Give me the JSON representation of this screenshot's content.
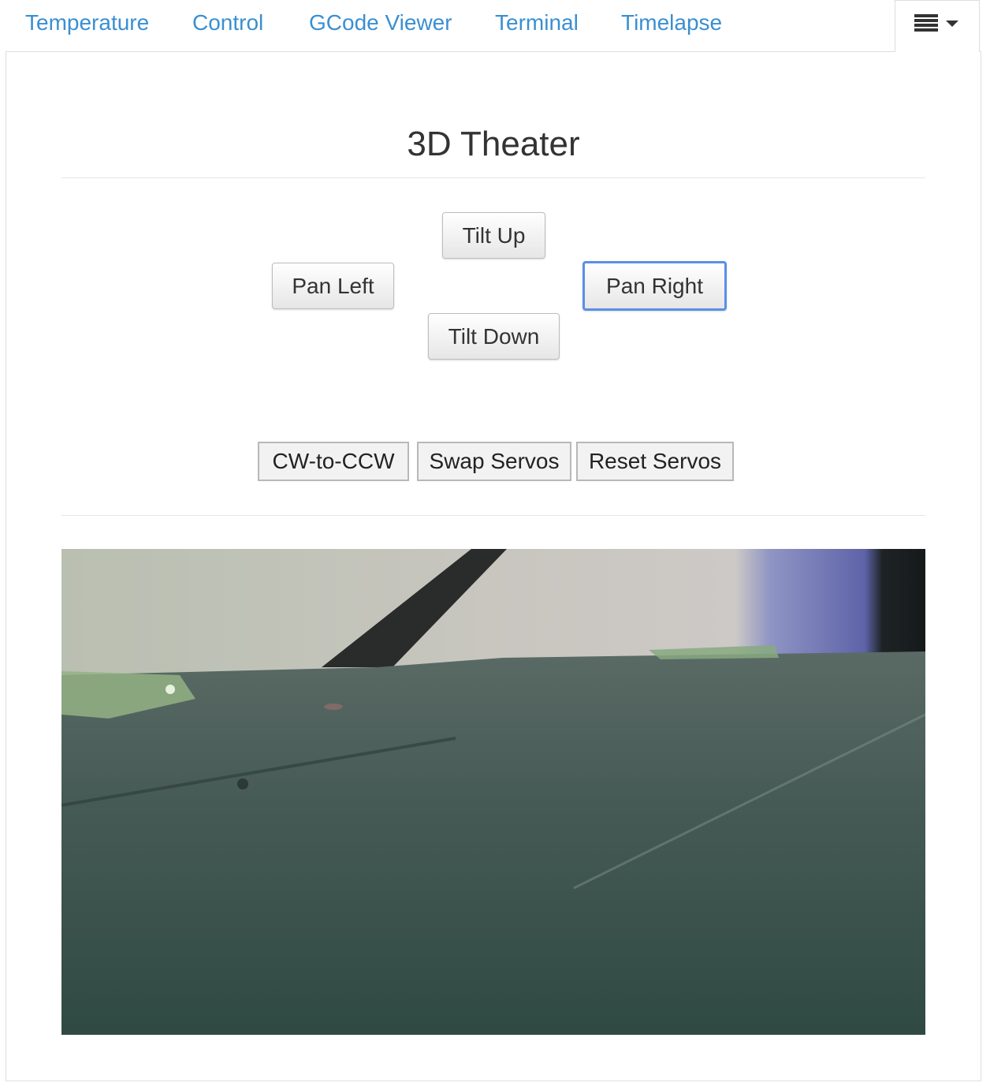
{
  "tabs": [
    {
      "label": "Temperature"
    },
    {
      "label": "Control"
    },
    {
      "label": "GCode Viewer"
    },
    {
      "label": "Terminal"
    },
    {
      "label": "Timelapse"
    }
  ],
  "menu": {
    "icon": "list-icon",
    "caret_icon": "caret-down-icon"
  },
  "plugin": {
    "title": "3D Theater",
    "buttons": {
      "tilt_up": "Tilt Up",
      "pan_left": "Pan Left",
      "pan_right": "Pan Right",
      "tilt_down": "Tilt Down",
      "cw_to_ccw": "CW-to-CCW",
      "swap_servos": "Swap Servos",
      "reset_servos": "Reset Servos"
    },
    "focused_button": "Pan Right"
  },
  "colors": {
    "link": "#3a8fd1",
    "focus_ring": "#5b8fe8",
    "text": "#333333"
  }
}
